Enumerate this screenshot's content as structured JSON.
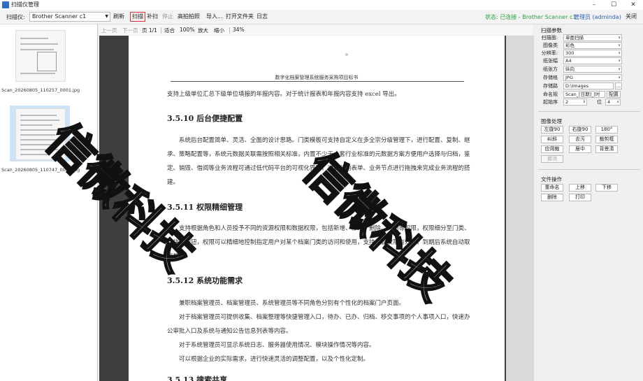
{
  "window": {
    "title": "扫描仪管理",
    "min": "–",
    "max": "☐",
    "close": "✕"
  },
  "toolbar": {
    "scanner_label": "扫描仪:",
    "scanner_value": "Brother Scanner c1",
    "refresh": "刷新",
    "scan": "扫描",
    "rescan": "补扫",
    "stop": "停止",
    "hd_capture": "高拍拍照",
    "import": "导入...",
    "open_folder": "打开文件夹",
    "log": "日志",
    "status": "状态: 已连接 - Brother Scanner c1",
    "user": "管理员 (adminda)",
    "close": "关闭"
  },
  "thumbnails": [
    {
      "caption": "Scan_20260805_110257_0001.jpg",
      "selected": false
    },
    {
      "caption": "Scan_20260805_110747_0001.jpg",
      "selected": true
    }
  ],
  "viewer_bar": {
    "prev": "上一页",
    "next": "下一页",
    "page": "页 1/1",
    "fit": "适合",
    "zoom100": "100%",
    "zoom_in": "放大",
    "zoom_out": "缩小",
    "zoom": "34%"
  },
  "page": {
    "header": "数字化档案管理系统服务采购项目标书",
    "p1": "支持上级单位汇总下级单位填报的年报内容。对于统计报表和年报内容支持 excel 导出。",
    "h1": "3.5.10 后台便捷配置",
    "p2": "系统后台配置简单、灵活、全面的设计思路。门类模板可支持自定义在多全宗分级管理下，进行配置、复制、继承、策略配置等，系统元数据关联需按照相关标准，内置不少于十套行业标准的元数据方案方便用户选择与归档，鉴定、销毁、借阅等业务流程可通过低代码平台的可视化界面，对封装的表单、业务节点进行拖拽来完成业务流程的搭建。",
    "h2": "3.5.11 权限精细管理",
    "p3": "支持根据角色和人员授予不同的资源权限和数据权限，包括新增、修改、删除、复制等权限，权限细分至门类、模块和按钮，权限可以精细地控制指定用户对某个档案门类的访问和使用，支持设置权限有效期，到期后系统自动取消权限。",
    "h3": "3.5.12 系统功能需求",
    "p4": "兼职档案管理员、档案管理员、系统管理员等不同角色分别有个性化的档案门户页面。",
    "p5": "对于档案管理员可提供收集、档案整理等快捷管理入口，待办、已办、归档、移交事项的个人事项入口，快速办公审批入口及系统与通知公告信息列表等内容。",
    "p6": "对于系统管理员可显示系统日志、服务器使用情况、模块操作情况等内容。",
    "p7": "可以根据企业的实际需求，进行快速灵活的调整配置，以及个性化定制。",
    "h4": "3.5.13 搜索共享",
    "mark": "。"
  },
  "watermark": "信微科技",
  "params": {
    "title": "扫描参数",
    "scan_side_label": "扫描面:",
    "scan_side": "单面扫描",
    "image_type_label": "图像类",
    "image_type": "彩色",
    "dpi_label": "分辨率:",
    "dpi": "300",
    "paper_label": "纸张幅",
    "paper": "A4",
    "orient_label": "纸张方",
    "orient": "纵向",
    "format_label": "存储格",
    "format": "JPG",
    "path_label": "存储路",
    "path": "D:\\Images",
    "browse": "...",
    "naming_label": "命名规",
    "naming": "Scan_[日期]_[时",
    "naming_btn": "配置",
    "start_label": "起始序",
    "start": "2",
    "digits_label": "位",
    "digits": "4"
  },
  "image_ops": {
    "title": "图像处理",
    "rot_left": "左旋90",
    "rot_right": "右旋90",
    "rot_180": "180°",
    "deskew": "纠斜",
    "denoise": "去污",
    "crop": "裁剪框",
    "apply_crop": "应用裁",
    "center": "居中",
    "remove_bg": "背景清",
    "undo": "撤消"
  },
  "file_ops": {
    "title": "文件操作",
    "rename": "重命名",
    "up": "上移",
    "down": "下移",
    "delete": "删除",
    "print": "打印"
  }
}
